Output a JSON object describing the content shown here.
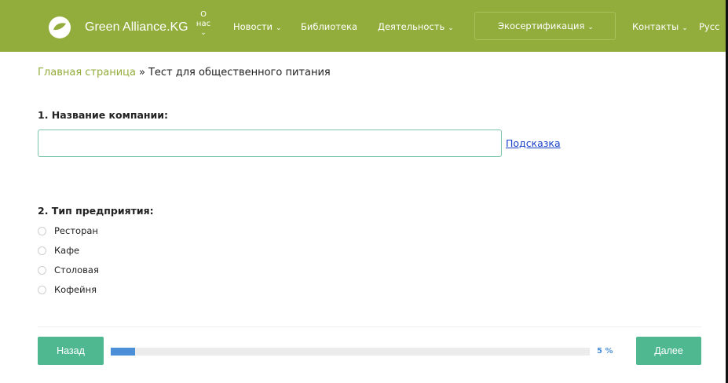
{
  "nav": {
    "brand": "Green Alliance.KG",
    "about_label": "О нас",
    "about_line1": "О",
    "about_line2": "нас",
    "items": [
      {
        "label": "Новости",
        "has_dropdown": true
      },
      {
        "label": "Библиотека",
        "has_dropdown": false
      },
      {
        "label": "Деятельность",
        "has_dropdown": true
      },
      {
        "label": "Экосертификация",
        "has_dropdown": true
      },
      {
        "label": "Контакты",
        "has_dropdown": true
      },
      {
        "label": "Русс",
        "has_dropdown": false
      }
    ],
    "chevron": "⌄"
  },
  "breadcrumb": {
    "home": "Главная страница",
    "separator": "»",
    "current": "Тест для общественного питания"
  },
  "question1": {
    "title": "1.  Название компании:",
    "value": "",
    "hint": "Подсказка"
  },
  "question2": {
    "title": "2.  Тип предприятия:",
    "options": [
      "Ресторан",
      "Кафе",
      "Столовая",
      "Кофейня"
    ]
  },
  "footer": {
    "back_label": "Назад",
    "next_label": "Далее",
    "progress_percent": 5,
    "progress_text": "5 %"
  },
  "colors": {
    "navbar": "#92ad3c",
    "button": "#4fb891",
    "progress": "#4a8fd8",
    "link": "#1a3fc8"
  },
  "icons": {
    "logo": "leaf-logo-icon",
    "dropdown": "chevron-down-icon",
    "radio": "radio-unchecked-icon"
  }
}
